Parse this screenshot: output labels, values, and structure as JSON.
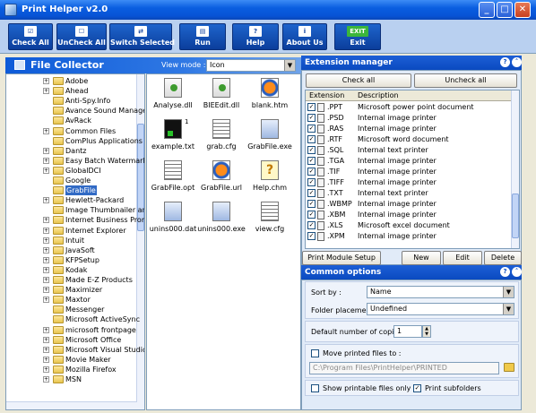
{
  "window": {
    "title": "Print Helper v2.0"
  },
  "toolbar": [
    {
      "label": "Check All",
      "icon": "check-all-icon"
    },
    {
      "label": "UnCheck All",
      "icon": "uncheck-all-icon"
    },
    {
      "label": "Switch Selected",
      "icon": "switch-icon"
    },
    {
      "label": "Run",
      "icon": "run-icon"
    },
    {
      "label": "Help",
      "icon": "help-icon"
    },
    {
      "label": "About Us",
      "icon": "about-icon"
    },
    {
      "label": "Exit",
      "icon": "exit-icon",
      "icon_text": "EXIT"
    }
  ],
  "file_collector": {
    "title": "File Collector",
    "view_mode_label": "View mode :",
    "view_mode_value": "Icon",
    "tree": [
      {
        "label": "Adobe",
        "expand": true
      },
      {
        "label": "Ahead",
        "expand": true
      },
      {
        "label": "Anti-Spy.Info",
        "expand": false
      },
      {
        "label": "Avance Sound Manage",
        "expand": false
      },
      {
        "label": "AvRack",
        "expand": false
      },
      {
        "label": "Common Files",
        "expand": true
      },
      {
        "label": "ComPlus Applications",
        "expand": false
      },
      {
        "label": "Dantz",
        "expand": true
      },
      {
        "label": "Easy Batch Watermark",
        "expand": true
      },
      {
        "label": "GlobalDCI",
        "expand": true
      },
      {
        "label": "Google",
        "expand": false
      },
      {
        "label": "GrabFile",
        "expand": false,
        "selected": true
      },
      {
        "label": "Hewlett-Packard",
        "expand": true
      },
      {
        "label": "Image Thumbnailer and",
        "expand": false
      },
      {
        "label": "Internet Business Promo",
        "expand": true
      },
      {
        "label": "Internet Explorer",
        "expand": true
      },
      {
        "label": "Intuit",
        "expand": true
      },
      {
        "label": "JavaSoft",
        "expand": true
      },
      {
        "label": "KFPSetup",
        "expand": true
      },
      {
        "label": "Kodak",
        "expand": true
      },
      {
        "label": "Made E-Z Products",
        "expand": true
      },
      {
        "label": "Maximizer",
        "expand": true
      },
      {
        "label": "Maxtor",
        "expand": true
      },
      {
        "label": "Messenger",
        "expand": false
      },
      {
        "label": "Microsoft ActiveSync",
        "expand": false
      },
      {
        "label": "microsoft frontpage",
        "expand": true
      },
      {
        "label": "Microsoft Office",
        "expand": true
      },
      {
        "label": "Microsoft Visual Studio",
        "expand": true
      },
      {
        "label": "Movie Maker",
        "expand": true
      },
      {
        "label": "Mozilla Firefox",
        "expand": true
      },
      {
        "label": "MSN",
        "expand": true
      }
    ],
    "files": [
      {
        "name": "Analyse.dll",
        "icon": "dll"
      },
      {
        "name": "BIEEdit.dll",
        "icon": "dll"
      },
      {
        "name": "blank.htm",
        "icon": "web"
      },
      {
        "name": "example.txt",
        "icon": "blk",
        "badge": "1"
      },
      {
        "name": "grab.cfg",
        "icon": "txt"
      },
      {
        "name": "GrabFile.exe",
        "icon": "exe"
      },
      {
        "name": "GrabFile.opt",
        "icon": "txt"
      },
      {
        "name": "GrabFile.url",
        "icon": "web"
      },
      {
        "name": "Help.chm",
        "icon": "chm"
      },
      {
        "name": "unins000.dat",
        "icon": "exe"
      },
      {
        "name": "unins000.exe",
        "icon": "exe"
      },
      {
        "name": "view.cfg",
        "icon": "txt"
      }
    ]
  },
  "extension_manager": {
    "title": "Extension manager",
    "check_all": "Check all",
    "uncheck_all": "Uncheck all",
    "col_ext": "Extension",
    "col_desc": "Description",
    "rows": [
      {
        "ext": ".PPT",
        "desc": "Microsoft power point document"
      },
      {
        "ext": ".PSD",
        "desc": "Internal image printer"
      },
      {
        "ext": ".RAS",
        "desc": "Internal image printer"
      },
      {
        "ext": ".RTF",
        "desc": "Microsoft word document"
      },
      {
        "ext": ".SQL",
        "desc": "Internal text printer"
      },
      {
        "ext": ".TGA",
        "desc": "Internal image printer"
      },
      {
        "ext": ".TIF",
        "desc": "Internal image printer"
      },
      {
        "ext": ".TIFF",
        "desc": "Internal image printer"
      },
      {
        "ext": ".TXT",
        "desc": "Internal text printer"
      },
      {
        "ext": ".WBMP",
        "desc": "Internal image printer"
      },
      {
        "ext": ".XBM",
        "desc": "Internal image printer"
      },
      {
        "ext": ".XLS",
        "desc": "Microsoft excel document"
      },
      {
        "ext": ".XPM",
        "desc": "Internal image printer"
      }
    ],
    "setup_btn": "Print Module Setup",
    "new_btn": "New",
    "edit_btn": "Edit",
    "delete_btn": "Delete"
  },
  "common_options": {
    "title": "Common options",
    "sort_label": "Sort by :",
    "sort_value": "Name",
    "folder_label": "Folder placement :",
    "folder_value": "Undefined",
    "copies_label": "Default number of copies :",
    "copies_value": "1",
    "move_label": "Move printed files to :",
    "move_path": "C:\\Program Files\\PrintHelper\\PRINTED",
    "show_printable": "Show printable files only",
    "print_sub": "Print subfolders"
  }
}
